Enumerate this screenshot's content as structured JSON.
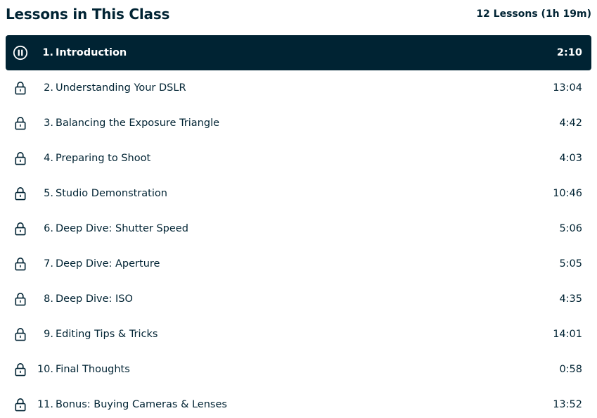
{
  "header": {
    "title": "Lessons in This Class",
    "summary": "12 Lessons (1h 19m)"
  },
  "lessons": [
    {
      "number": "1.",
      "title": "Introduction",
      "duration": "2:10",
      "icon": "pause-icon",
      "active": true
    },
    {
      "number": "2.",
      "title": "Understanding Your DSLR",
      "duration": "13:04",
      "icon": "lock-icon",
      "active": false
    },
    {
      "number": "3.",
      "title": "Balancing the Exposure Triangle",
      "duration": "4:42",
      "icon": "lock-icon",
      "active": false
    },
    {
      "number": "4.",
      "title": "Preparing to Shoot",
      "duration": "4:03",
      "icon": "lock-icon",
      "active": false
    },
    {
      "number": "5.",
      "title": "Studio Demonstration",
      "duration": "10:46",
      "icon": "lock-icon",
      "active": false
    },
    {
      "number": "6.",
      "title": "Deep Dive: Shutter Speed",
      "duration": "5:06",
      "icon": "lock-icon",
      "active": false
    },
    {
      "number": "7.",
      "title": "Deep Dive: Aperture",
      "duration": "5:05",
      "icon": "lock-icon",
      "active": false
    },
    {
      "number": "8.",
      "title": "Deep Dive: ISO",
      "duration": "4:35",
      "icon": "lock-icon",
      "active": false
    },
    {
      "number": "9.",
      "title": "Editing Tips & Tricks",
      "duration": "14:01",
      "icon": "lock-icon",
      "active": false
    },
    {
      "number": "10.",
      "title": "Final Thoughts",
      "duration": "0:58",
      "icon": "lock-icon",
      "active": false
    },
    {
      "number": "11.",
      "title": "Bonus: Buying Cameras & Lenses",
      "duration": "13:52",
      "icon": "lock-icon",
      "active": false
    }
  ],
  "colors": {
    "primary": "#002333",
    "active_text": "#ffffff",
    "background": "#ffffff"
  }
}
